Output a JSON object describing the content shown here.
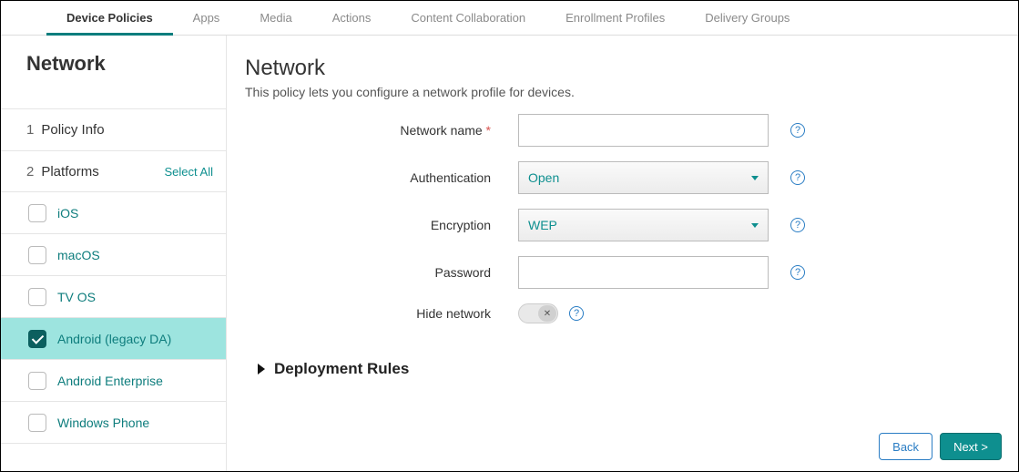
{
  "tabs": [
    "Device Policies",
    "Apps",
    "Media",
    "Actions",
    "Content Collaboration",
    "Enrollment Profiles",
    "Delivery Groups"
  ],
  "active_tab_index": 0,
  "sidebar": {
    "title": "Network",
    "steps": {
      "one": {
        "num": "1",
        "label": "Policy Info"
      },
      "two": {
        "num": "2",
        "label": "Platforms",
        "select_all": "Select All"
      }
    },
    "platforms": [
      {
        "label": "iOS",
        "checked": false,
        "selected": false
      },
      {
        "label": "macOS",
        "checked": false,
        "selected": false
      },
      {
        "label": "TV OS",
        "checked": false,
        "selected": false
      },
      {
        "label": "Android (legacy DA)",
        "checked": true,
        "selected": true
      },
      {
        "label": "Android Enterprise",
        "checked": false,
        "selected": false
      },
      {
        "label": "Windows Phone",
        "checked": false,
        "selected": false
      }
    ]
  },
  "main": {
    "title": "Network",
    "desc": "This policy lets you configure a network profile for devices.",
    "fields": {
      "network_name": {
        "label": "Network name",
        "required": "*",
        "value": ""
      },
      "authentication": {
        "label": "Authentication",
        "value": "Open"
      },
      "encryption": {
        "label": "Encryption",
        "value": "WEP"
      },
      "password": {
        "label": "Password",
        "value": ""
      },
      "hide_network": {
        "label": "Hide network",
        "state": "off",
        "glyph": "✕"
      }
    },
    "deployment_rules": "Deployment Rules"
  },
  "footer": {
    "back": "Back",
    "next": "Next >"
  }
}
